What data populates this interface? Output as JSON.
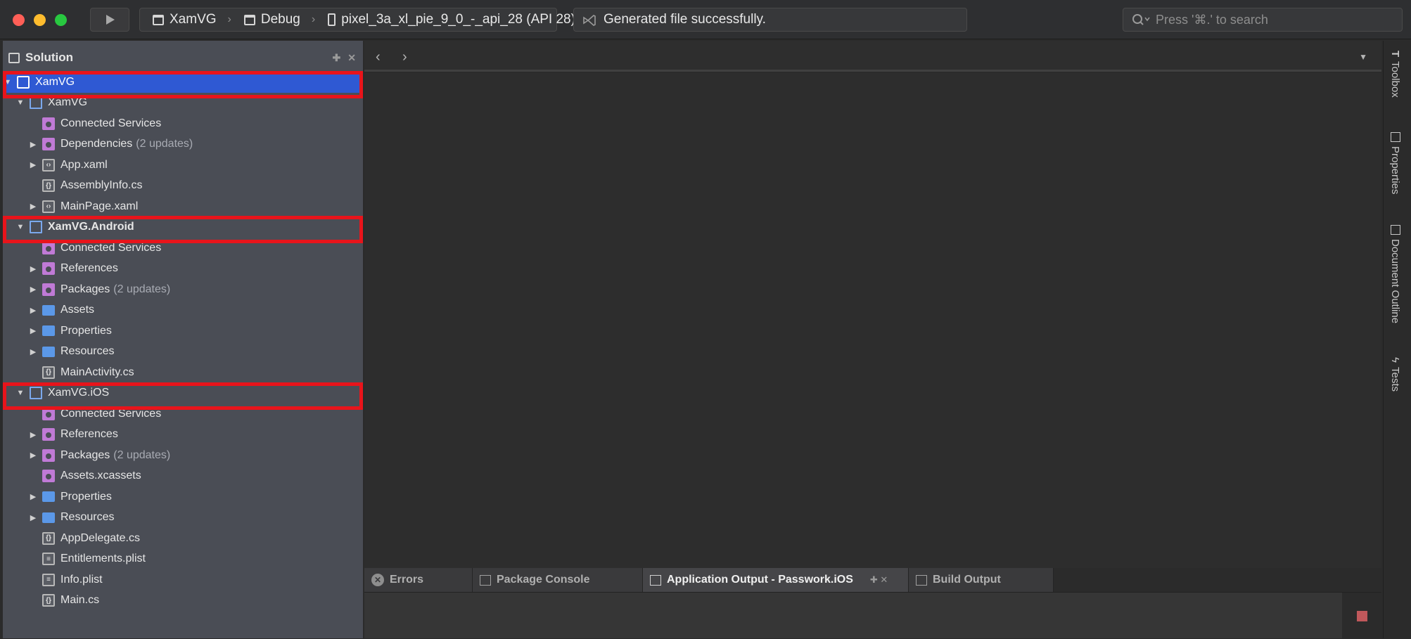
{
  "toolbar": {
    "breadcrumbs": [
      {
        "label": "XamVG",
        "icon": "window-icon"
      },
      {
        "label": "Debug",
        "icon": "window-icon"
      },
      {
        "label": "pixel_3a_xl_pie_9_0_-_api_28 (API 28)",
        "icon": "phone-icon"
      }
    ],
    "status": "Generated file successfully.",
    "search_placeholder": "Press '⌘.' to search"
  },
  "solution": {
    "title": "Solution",
    "items": [
      {
        "label": "XamVG",
        "level": 0,
        "expanded": true,
        "icon": "solution-icon",
        "selected": true,
        "highlighted": true
      },
      {
        "label": "XamVG",
        "level": 1,
        "expanded": true,
        "icon": "project-icon"
      },
      {
        "label": "Connected Services",
        "level": 2,
        "icon": "connected-services-icon"
      },
      {
        "label": "Dependencies",
        "extra": "(2 updates)",
        "level": 2,
        "collapsed": true,
        "icon": "dependencies-icon"
      },
      {
        "label": "App.xaml",
        "level": 2,
        "collapsed": true,
        "icon": "xaml-file-icon"
      },
      {
        "label": "AssemblyInfo.cs",
        "level": 2,
        "icon": "cs-file-icon"
      },
      {
        "label": "MainPage.xaml",
        "level": 2,
        "collapsed": true,
        "icon": "xaml-file-icon"
      },
      {
        "label": "XamVG.Android",
        "level": 1,
        "expanded": true,
        "icon": "project-icon",
        "bold": true,
        "highlighted": true
      },
      {
        "label": "Connected Services",
        "level": 2,
        "icon": "connected-services-icon"
      },
      {
        "label": "References",
        "level": 2,
        "collapsed": true,
        "icon": "references-icon"
      },
      {
        "label": "Packages",
        "extra": "(2 updates)",
        "level": 2,
        "collapsed": true,
        "icon": "packages-icon"
      },
      {
        "label": "Assets",
        "level": 2,
        "collapsed": true,
        "icon": "folder-icon"
      },
      {
        "label": "Properties",
        "level": 2,
        "collapsed": true,
        "icon": "folder-icon"
      },
      {
        "label": "Resources",
        "level": 2,
        "collapsed": true,
        "icon": "folder-icon"
      },
      {
        "label": "MainActivity.cs",
        "level": 2,
        "icon": "cs-file-icon"
      },
      {
        "label": "XamVG.iOS",
        "level": 1,
        "expanded": true,
        "icon": "project-icon",
        "highlighted": true
      },
      {
        "label": "Connected Services",
        "level": 2,
        "icon": "connected-services-icon"
      },
      {
        "label": "References",
        "level": 2,
        "collapsed": true,
        "icon": "references-icon"
      },
      {
        "label": "Packages",
        "extra": "(2 updates)",
        "level": 2,
        "collapsed": true,
        "icon": "packages-icon"
      },
      {
        "label": "Assets.xcassets",
        "level": 2,
        "icon": "assets-icon"
      },
      {
        "label": "Properties",
        "level": 2,
        "collapsed": true,
        "icon": "folder-icon"
      },
      {
        "label": "Resources",
        "level": 2,
        "collapsed": true,
        "icon": "folder-icon"
      },
      {
        "label": "AppDelegate.cs",
        "level": 2,
        "icon": "cs-file-icon"
      },
      {
        "label": "Entitlements.plist",
        "level": 2,
        "icon": "plist-file-icon"
      },
      {
        "label": "Info.plist",
        "level": 2,
        "icon": "plist-file-icon"
      },
      {
        "label": "Main.cs",
        "level": 2,
        "icon": "cs-file-icon"
      }
    ]
  },
  "right_sidebar": {
    "tabs": [
      "Toolbox",
      "Properties",
      "Document Outline",
      "Tests"
    ]
  },
  "bottom_pads": {
    "tabs": [
      {
        "label": "Errors",
        "icon": "error-icon"
      },
      {
        "label": "Package Console",
        "icon": "console-icon"
      },
      {
        "label": "Application Output - Passwork.iOS",
        "icon": "output-icon",
        "active": true
      },
      {
        "label": "Build Output",
        "icon": "build-icon"
      }
    ]
  },
  "colors": {
    "selection": "#2f59d3",
    "highlight_box": "#e8141b",
    "solution_bg": "#4a4d55",
    "folder": "#5b98e8",
    "pink_icon": "#c07ad6"
  }
}
